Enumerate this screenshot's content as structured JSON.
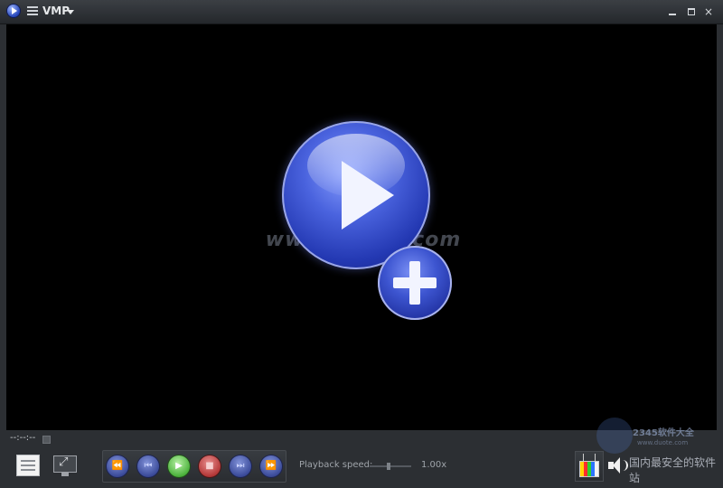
{
  "titlebar": {
    "title": "VMP",
    "icons": {
      "logo": "vmp-logo-icon",
      "menu": "hamburger-menu-icon",
      "dropdown": "chevron-down-icon"
    },
    "minimize_icon": "minimize-icon",
    "maximize_icon": "maximize-icon",
    "close_glyph": "×"
  },
  "video": {
    "watermark": "www.DuoTe.com",
    "center_icon": "play-add-icon"
  },
  "timeline": {
    "time": "--:--:--"
  },
  "transport": {
    "rewind": "⏪",
    "prev": "⏮",
    "play": "▶",
    "stop": "■",
    "next": "⏭",
    "forward": "⏩"
  },
  "speed": {
    "label": "Playback speed:",
    "value": "1.00x"
  },
  "branding": {
    "site_name": "2345软件大全",
    "site_url": "www.duote.com",
    "slogan": "国内最安全的软件站"
  },
  "colors": {
    "accent_blue": "#3b55d6",
    "play_green": "#4cb23c",
    "stop_red": "#b43838"
  }
}
